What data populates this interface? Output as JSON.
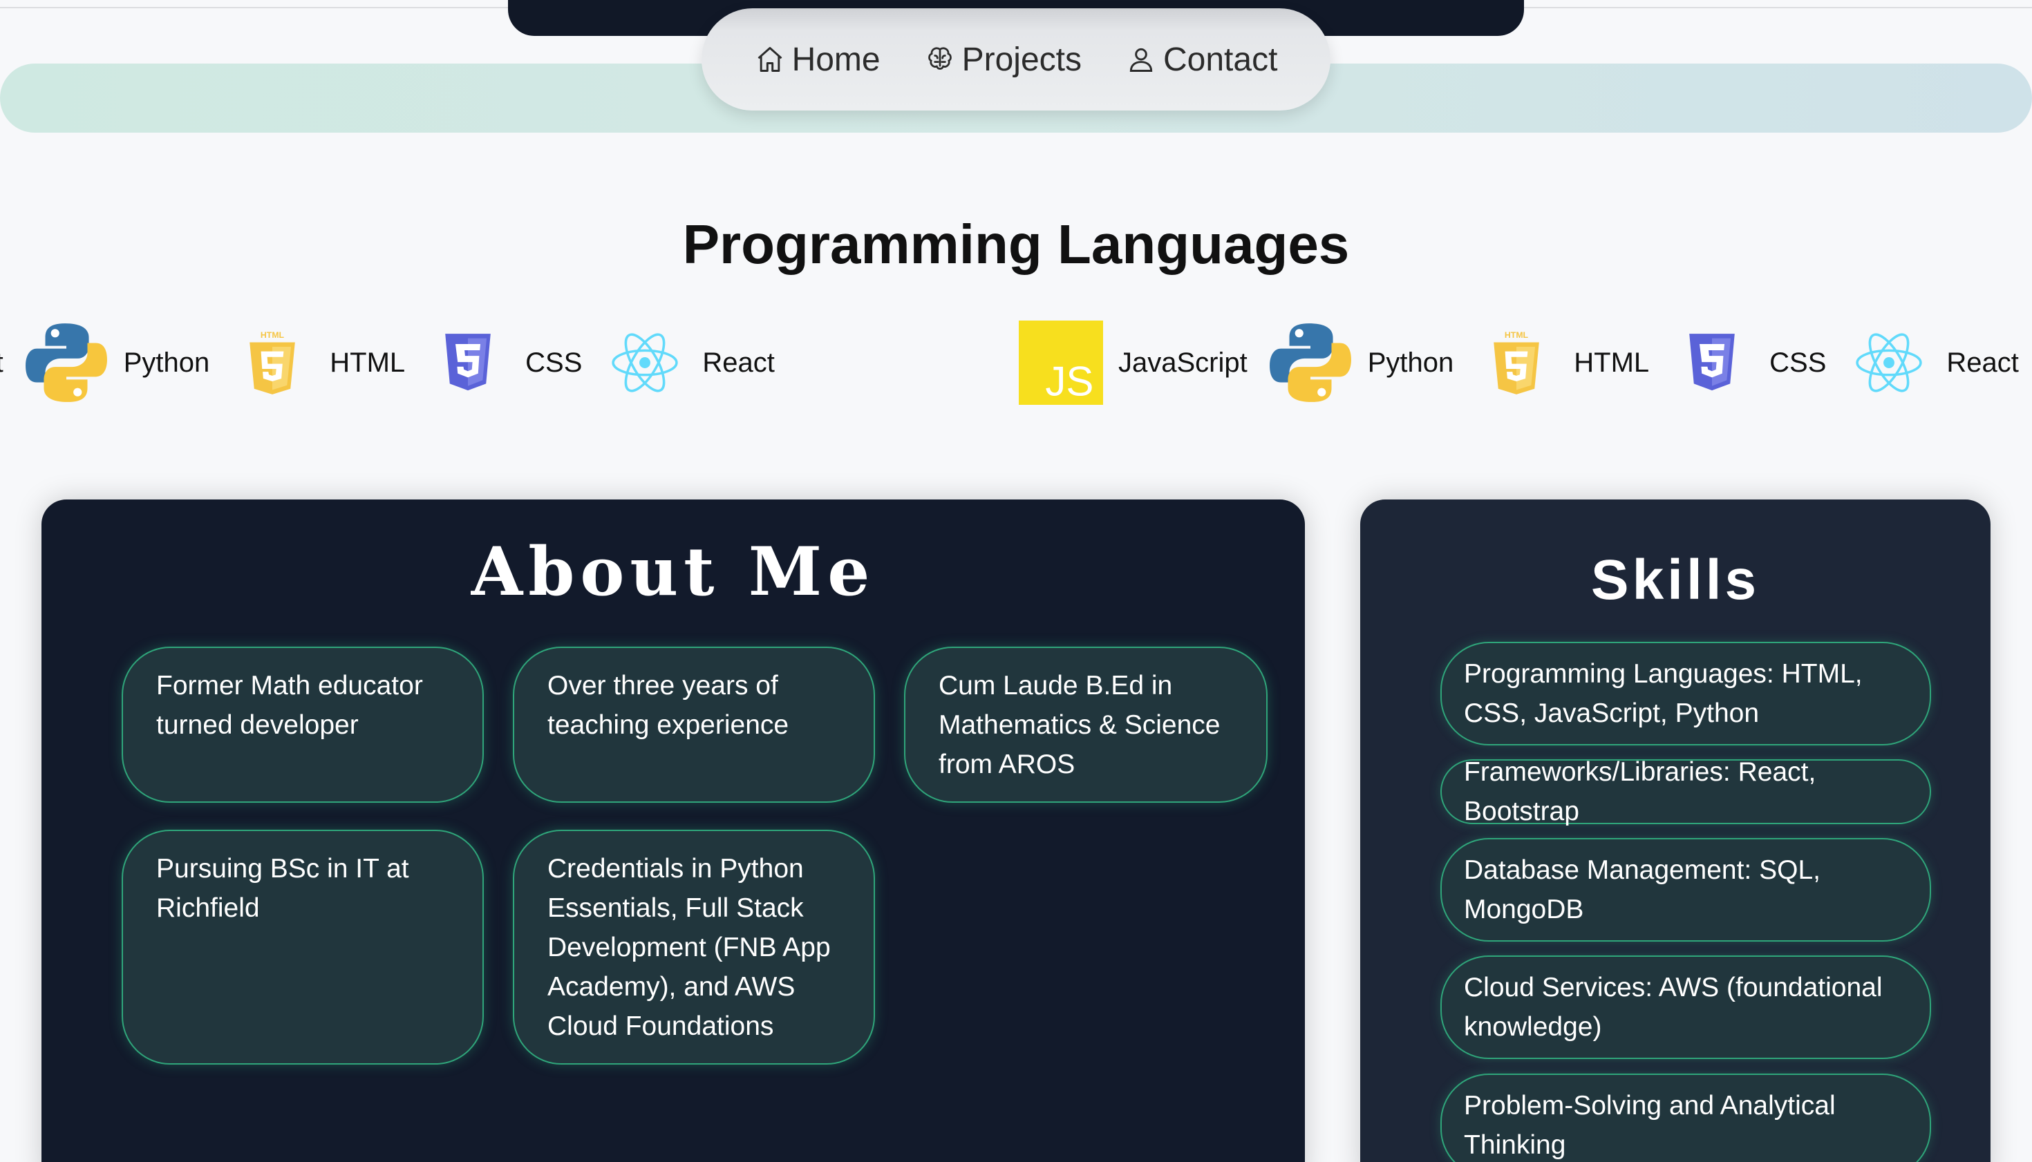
{
  "nav": {
    "items": [
      {
        "label": "Home",
        "icon": "home-icon"
      },
      {
        "label": "Projects",
        "icon": "brain-icon"
      },
      {
        "label": "Contact",
        "icon": "user-icon"
      }
    ]
  },
  "languages": {
    "title": "Programming Languages",
    "items": [
      {
        "label": "JavaScript",
        "icon": "javascript-logo-icon",
        "color": "#f7df1e"
      },
      {
        "label": "Python",
        "icon": "python-logo-icon",
        "color": "#3776ab"
      },
      {
        "label": "HTML",
        "icon": "html5-logo-icon",
        "color": "#f5c544"
      },
      {
        "label": "CSS",
        "icon": "css3-logo-icon",
        "color": "#5a62d8"
      },
      {
        "label": "React",
        "icon": "react-logo-icon",
        "color": "#61dafb"
      }
    ],
    "html_badge": "HTML",
    "js_badge": "JS"
  },
  "about": {
    "title": "About Me",
    "items": [
      "Former Math educator turned developer",
      "Over three years of teaching experience",
      "Cum Laude B.Ed in Mathematics & Science from AROS",
      "Pursuing BSc in IT at Richfield",
      "Credentials in Python Essentials, Full Stack Development (FNB App Academy), and AWS Cloud Foundations"
    ]
  },
  "skills": {
    "title": "Skills",
    "items": [
      "Programming Languages: HTML, CSS, JavaScript, Python",
      "Frameworks/Libraries: React, Bootstrap",
      "Database Management: SQL, MongoDB",
      "Cloud Services: AWS (foundational knowledge)",
      "Problem-Solving and Analytical Thinking"
    ]
  },
  "colors": {
    "card_dark": "#121a2b",
    "skills_card": "#1d2637",
    "bubble_fill": "#21363d",
    "bubble_border": "#2fa57a"
  }
}
